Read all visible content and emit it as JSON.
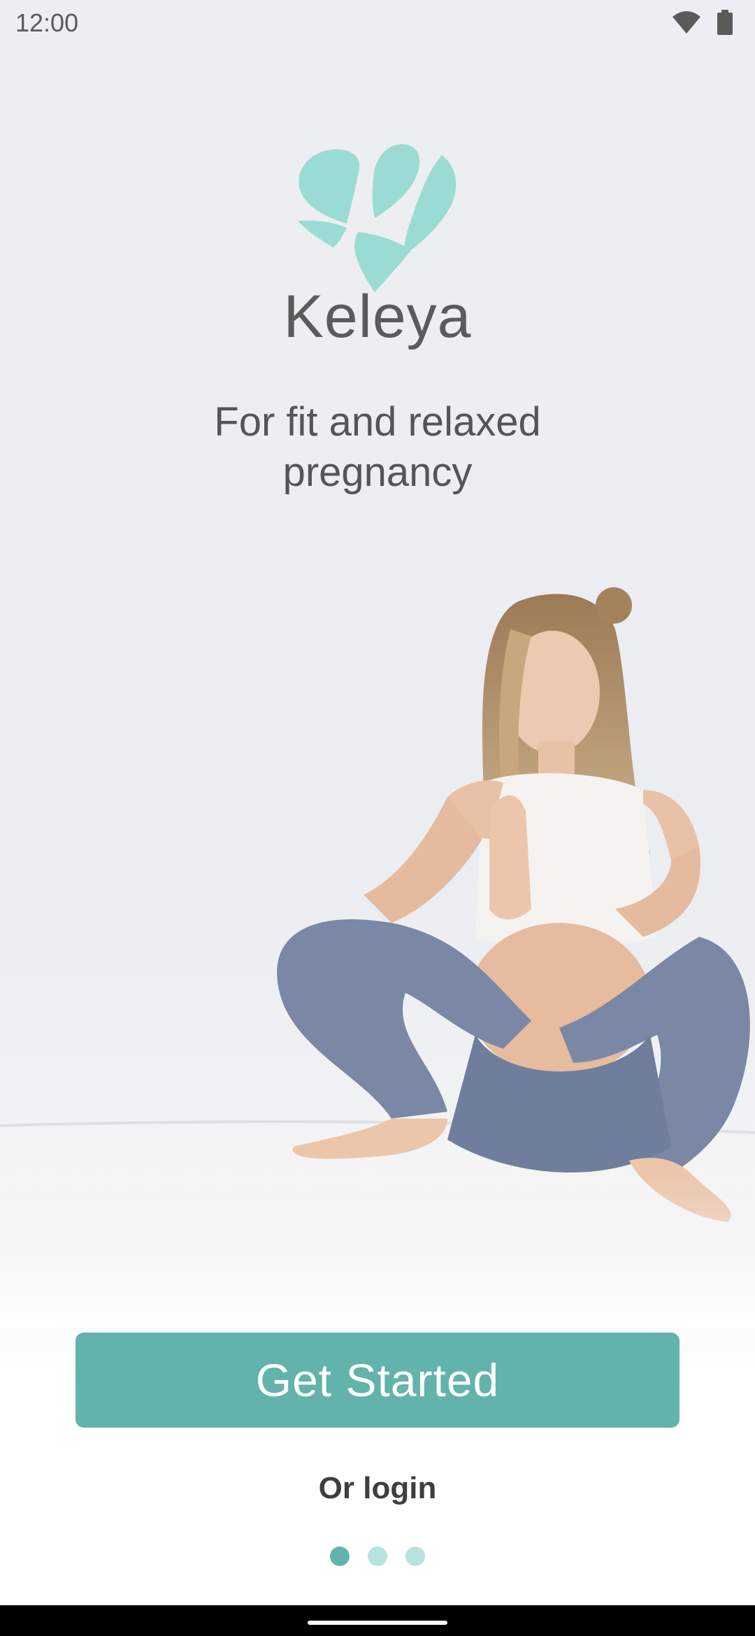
{
  "status_bar": {
    "time": "12:00",
    "icons": [
      "wifi-icon",
      "battery-icon"
    ]
  },
  "brand": {
    "name": "Keleya",
    "logo_color": "#9adcd3"
  },
  "tagline": "For fit and relaxed pregnancy",
  "cta": {
    "label": "Get Started",
    "color": "#62b3ab"
  },
  "login_link": "Or login",
  "pager": {
    "count": 3,
    "active_index": 0
  },
  "colors": {
    "accent": "#62b3ab",
    "accent_light": "#b6e3de",
    "text": "#555555"
  }
}
